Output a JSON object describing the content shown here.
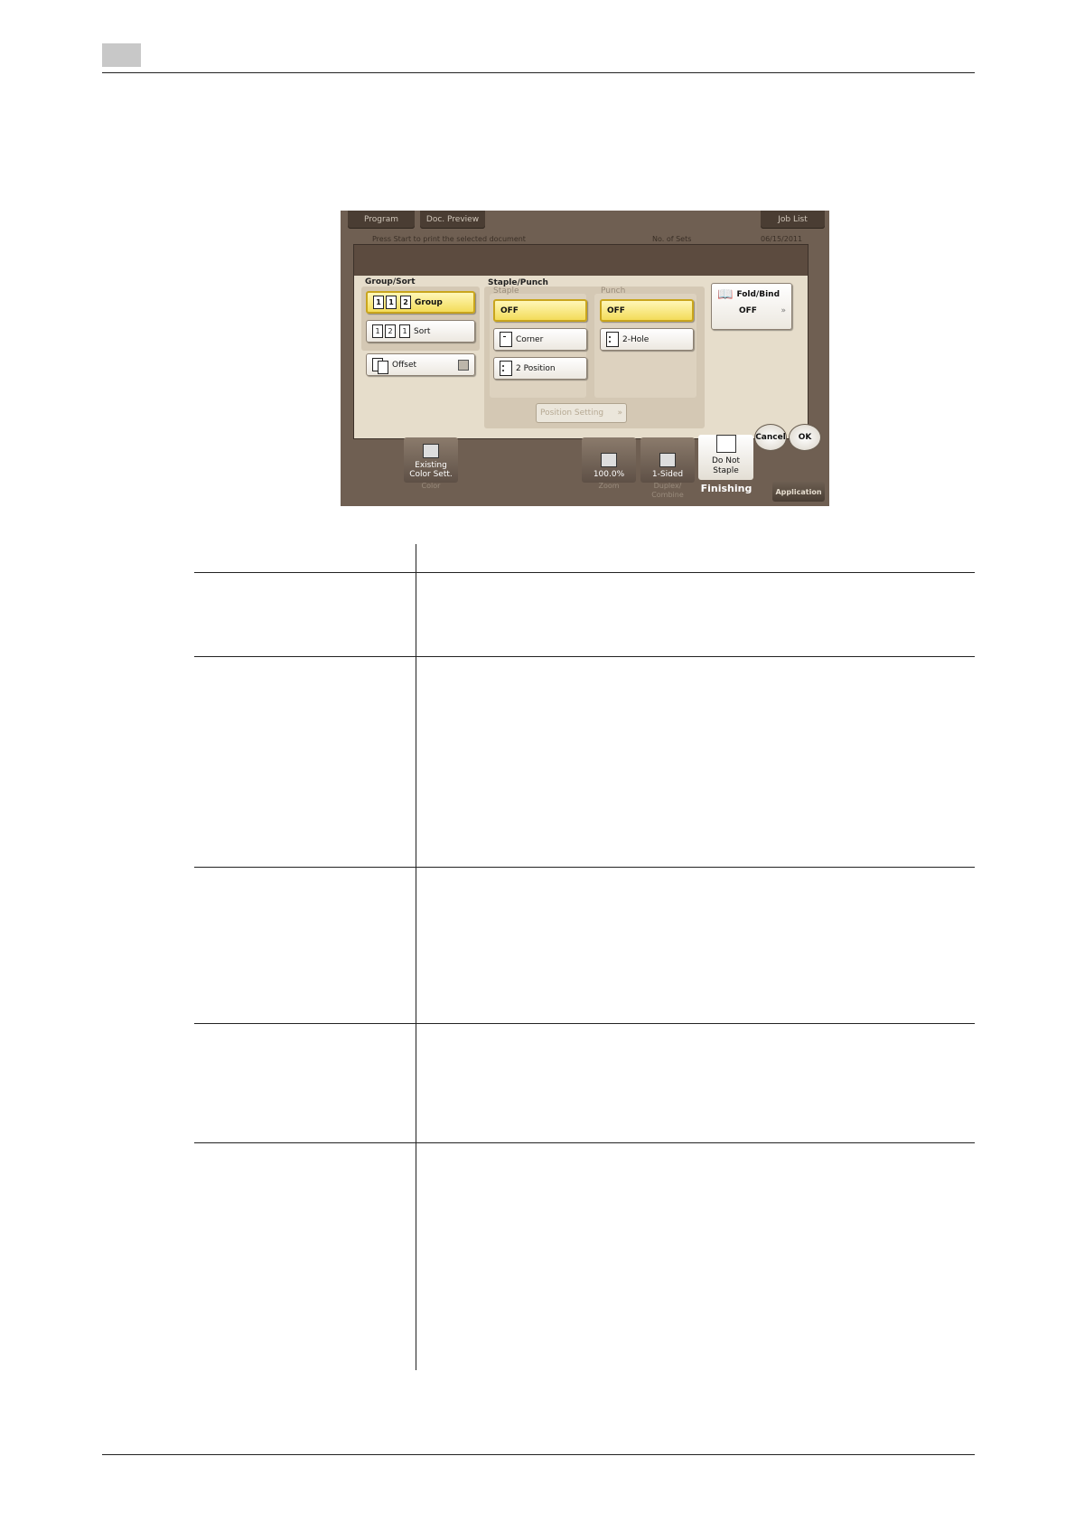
{
  "screen": {
    "top_buttons": {
      "program": "Program",
      "doc_preview": "Doc. Preview",
      "job_list": "Job List"
    },
    "status": {
      "message": "Press Start to print the selected document",
      "sets_label": "No. of Sets",
      "date": "06/15/2011"
    },
    "dialog": {
      "group_sort": {
        "title": "Group/Sort",
        "group_label": "Group",
        "sort_label": "Sort",
        "offset_label": "Offset"
      },
      "staple_punch": {
        "title": "Staple/Punch",
        "staple_label": "Staple",
        "punch_label": "Punch",
        "staple_off": "OFF",
        "corner": "Corner",
        "two_position": "2 Position",
        "punch_off": "OFF",
        "two_hole": "2-Hole",
        "position_setting": "Position Setting"
      },
      "fold_bind": {
        "title": "Fold/Bind",
        "value": "OFF"
      },
      "cancel": "Cancel",
      "ok": "OK"
    },
    "bottom": {
      "color_tile": {
        "line1": "Existing",
        "line2": "Color Sett.",
        "caption": "Color"
      },
      "zoom_tile": {
        "value": "100.0%",
        "caption": "Zoom"
      },
      "duplex_tile": {
        "value": "1-Sided",
        "caption1": "Duplex/",
        "caption2": "Combine"
      },
      "finishing_tile": {
        "line1": "Do Not",
        "line2": "Staple",
        "caption": "Finishing"
      },
      "application": "Application"
    }
  }
}
